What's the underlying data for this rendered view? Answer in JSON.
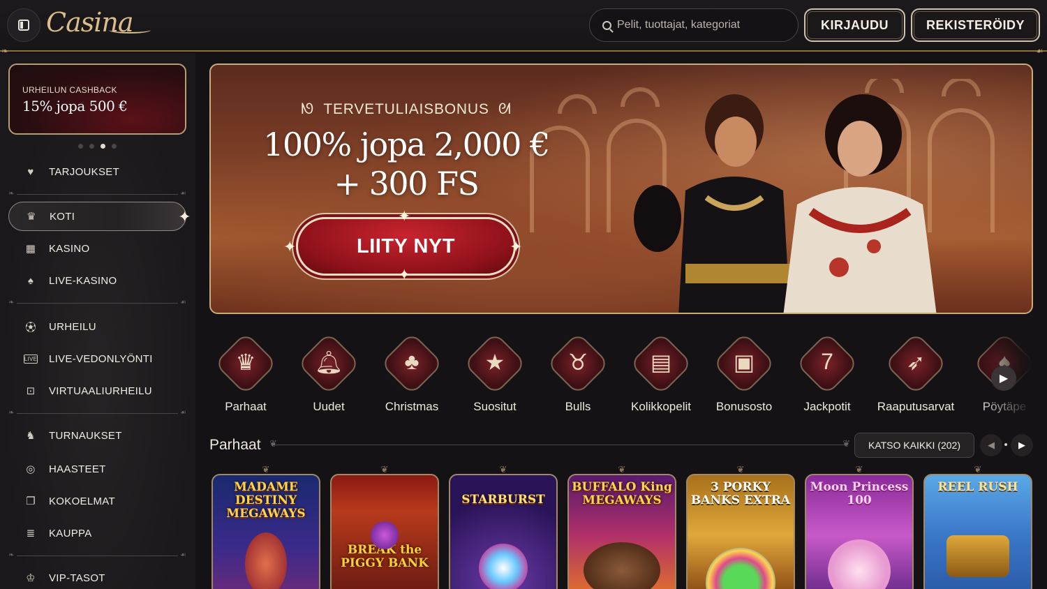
{
  "header": {
    "logo_text": "Casina",
    "search_placeholder": "Pelit, tuottajat, kategoriat",
    "login_label": "KIRJAUDU",
    "register_label": "REKISTERÖIDY"
  },
  "sidebar": {
    "promo": {
      "pretitle": "URHEILUN CASHBACK",
      "title": "15% jopa 500 €"
    },
    "carousel": {
      "count": 4,
      "active": 2
    },
    "items": [
      {
        "label": "TARJOUKSET",
        "icon": "gift-icon"
      },
      {
        "label": "KOTI",
        "icon": "crown-icon",
        "active": true
      },
      {
        "label": "KASINO",
        "icon": "slot-icon"
      },
      {
        "label": "LIVE-KASINO",
        "icon": "cards-icon"
      },
      {
        "label": "URHEILU",
        "icon": "soccer-ball-icon"
      },
      {
        "label": "LIVE-VEDONLYÖNTI",
        "icon": "live-icon"
      },
      {
        "label": "VIRTUAALIURHEILU",
        "icon": "virtual-sports-icon"
      },
      {
        "label": "TURNAUKSET",
        "icon": "tournament-icon"
      },
      {
        "label": "HAASTEET",
        "icon": "challenge-icon"
      },
      {
        "label": "KOKOELMAT",
        "icon": "collection-icon"
      },
      {
        "label": "KAUPPA",
        "icon": "coins-icon"
      },
      {
        "label": "VIP-TASOT",
        "icon": "vip-icon"
      }
    ]
  },
  "hero": {
    "kicker": "TERVETULIAISBONUS",
    "headline_line1": "100% jopa 2,000 €",
    "headline_line2": "+ 300 FS",
    "cta": "LIITY NYT"
  },
  "categories": [
    {
      "label": "Parhaat",
      "icon": "crown-icon",
      "glyph": "♛"
    },
    {
      "label": "Uudet",
      "icon": "bell-icon",
      "glyph": "🔔︎"
    },
    {
      "label": "Christmas",
      "icon": "tree-icon",
      "glyph": "♣"
    },
    {
      "label": "Suositut",
      "icon": "star-icon",
      "glyph": "★"
    },
    {
      "label": "Bulls",
      "icon": "bull-icon",
      "glyph": "♉"
    },
    {
      "label": "Kolikkopelit",
      "icon": "slot-machine-icon",
      "glyph": "▤"
    },
    {
      "label": "Bonusosto",
      "icon": "gift-box-icon",
      "glyph": "▣"
    },
    {
      "label": "Jackpotit",
      "icon": "seven-icon",
      "glyph": "7"
    },
    {
      "label": "Raaputusarvat",
      "icon": "rocket-icon",
      "glyph": "➶"
    },
    {
      "label": "Pöytäpe",
      "icon": "table-cards-icon",
      "glyph": "♠"
    }
  ],
  "section": {
    "title": "Parhaat",
    "see_all": "KATSO KAIKKI (202)"
  },
  "games": [
    {
      "title": "MADAME DESTINY MEGAWAYS"
    },
    {
      "title": "BREAK the PIGGY BANK"
    },
    {
      "title": "STARBURST"
    },
    {
      "title": "BUFFALO King MEGAWAYS"
    },
    {
      "title": "3 PORKY BANKS EXTRA"
    },
    {
      "title": "Moon Princess 100"
    },
    {
      "title": "REEL RUSH"
    }
  ]
}
